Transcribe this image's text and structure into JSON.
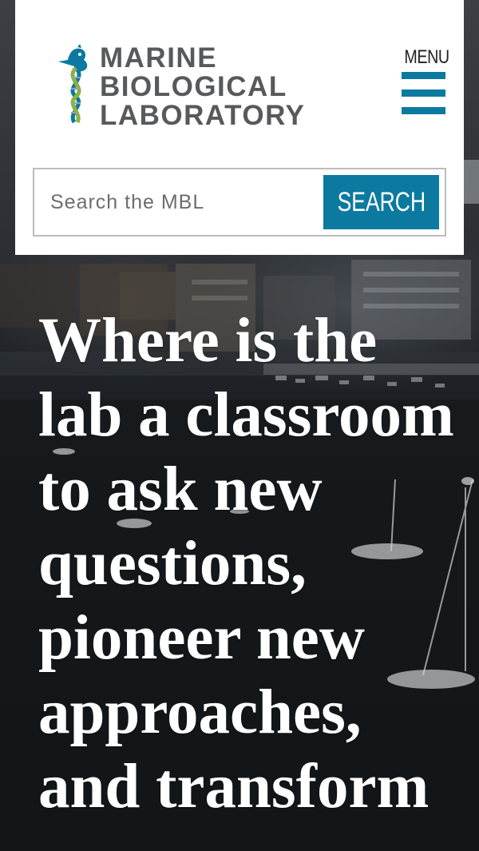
{
  "header": {
    "logo": {
      "lines": [
        "MARINE",
        "BIOLOGICAL",
        "LABORATORY"
      ],
      "icon": "seahorse-dna-icon",
      "text_color": "#58595b",
      "accent_colors": [
        "#0c7aa0",
        "#8ab33f"
      ]
    },
    "menu": {
      "label": "MENU",
      "icon": "hamburger-icon",
      "color": "#0c7aa0"
    },
    "search": {
      "placeholder": "Search the MBL",
      "value": "",
      "button_label": "SEARCH",
      "button_color": "#0c7aa0"
    }
  },
  "hero": {
    "headline": "Where is the lab a classroom to ask new questions, pioneer new approaches, and transform"
  }
}
